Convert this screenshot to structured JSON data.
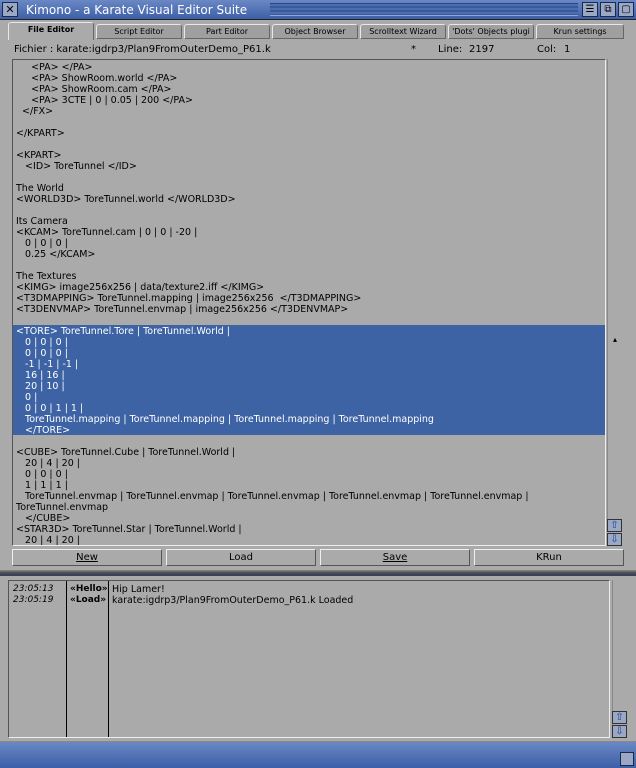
{
  "window": {
    "title": "Kimono - a Karate Visual Editor Suite",
    "close_glyph": "✕",
    "gadgets": [
      "☰",
      "⧉",
      "▢"
    ]
  },
  "tabs": [
    {
      "label": "File Editor",
      "active": true
    },
    {
      "label": "Script Editor",
      "active": false
    },
    {
      "label": "Part Editor",
      "active": false
    },
    {
      "label": "Object Browser",
      "active": false
    },
    {
      "label": "Scrolltext Wizard",
      "active": false
    },
    {
      "label": "'Dots' Objects plugi",
      "active": false
    },
    {
      "label": "Krun settings",
      "active": false
    }
  ],
  "fileinfo": {
    "file": "Fichier : karate:igdrp3/Plan9FromOuterDemo_P61.k",
    "modified": "*",
    "line_label": "Line:",
    "line_value": "2197",
    "col_label": "Col:",
    "col_value": "1"
  },
  "editor": {
    "lines": [
      "     <PA> </PA>",
      "     <PA> ShowRoom.world </PA>",
      "     <PA> ShowRoom.cam </PA>",
      "     <PA> 3CTE | 0 | 0.05 | 200 </PA>",
      "  </FX>",
      "",
      "</KPART>",
      "",
      "<KPART>",
      "   <ID> ToreTunnel </ID>",
      "",
      "The World",
      "<WORLD3D> ToreTunnel.world </WORLD3D>",
      "",
      "Its Camera",
      "<KCAM> ToreTunnel.cam | 0 | 0 | -20 |",
      "   0 | 0 | 0 |",
      "   0.25 </KCAM>",
      "",
      "The Textures",
      "<KIMG> image256x256 | data/texture2.iff </KIMG>",
      "<T3DMAPPING> ToreTunnel.mapping | image256x256  </T3DMAPPING>",
      "<T3DENVMAP> ToreTunnel.envmap | image256x256 </T3DENVMAP>",
      "",
      "<TORE> ToreTunnel.Tore | ToreTunnel.World |",
      "   0 | 0 | 0 |",
      "   0 | 0 | 0 |",
      "   -1 | -1 | -1 |",
      "   16 | 16 |",
      "   20 | 10 |",
      "   0 |",
      "   0 | 0 | 1 | 1 |",
      "   ToreTunnel.mapping | ToreTunnel.mapping | ToreTunnel.mapping | ToreTunnel.mapping",
      "   </TORE>",
      "",
      "<CUBE> ToreTunnel.Cube | ToreTunnel.World |",
      "   20 | 4 | 20 |",
      "   0 | 0 | 0 |",
      "   1 | 1 | 1 |",
      "   ToreTunnel.envmap | ToreTunnel.envmap | ToreTunnel.envmap | ToreTunnel.envmap | ToreTunnel.envmap |",
      "ToreTunnel.envmap",
      "   </CUBE>",
      "<STAR3D> ToreTunnel.Star | ToreTunnel.World |",
      "   20 | 4 | 20 |"
    ],
    "selected_from": 24,
    "selected_to": 33
  },
  "buttons": {
    "new": "New",
    "load": "Load",
    "save": "Save",
    "krun": "KRun"
  },
  "scroll": {
    "up": "⇧",
    "down": "⇩",
    "mark": "▴"
  },
  "log": {
    "entries": [
      {
        "time": "23:05:13",
        "tag": "«Hello»",
        "message": "Hip Lamer!"
      },
      {
        "time": "23:05:19",
        "tag": "«Load»",
        "message": "karate:igdrp3/Plan9FromOuterDemo_P61.k Loaded"
      }
    ]
  }
}
